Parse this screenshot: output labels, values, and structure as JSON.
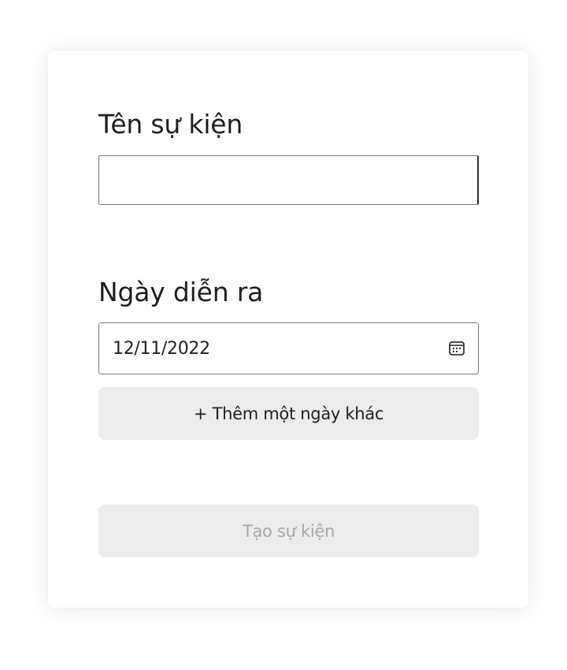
{
  "form": {
    "event_name_label": "Tên sự kiện",
    "event_name_value": "",
    "event_date_label": "Ngày diễn ra",
    "event_date_value": "12/11/2022",
    "calendar_icon": "calendar-icon",
    "add_date_button": "+ Thêm một ngày khác",
    "create_button": "Tạo sự kiện",
    "create_button_disabled": true
  },
  "colors": {
    "button_bg": "#ececec",
    "disabled_text": "#a7a7a7",
    "text": "#1f1f1f",
    "input_border": "#7a7a7a"
  }
}
